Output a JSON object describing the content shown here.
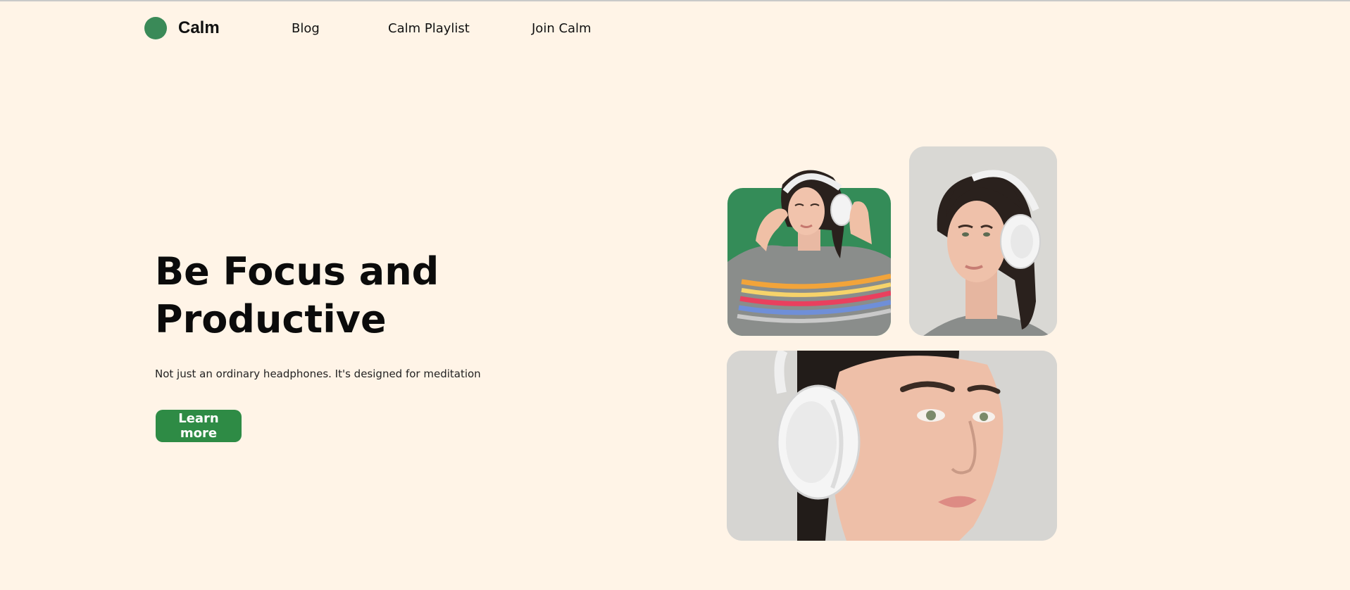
{
  "nav": {
    "brand": "Calm",
    "links": [
      "Blog",
      "Calm Playlist",
      "Join Calm"
    ]
  },
  "hero": {
    "title": "Be Focus and Productive",
    "subtitle": "Not just an ordinary headphones. It's designed for meditation",
    "cta": "Learn more"
  },
  "colors": {
    "background": "#fff4e7",
    "brand_green": "#3a8a58",
    "button_green": "#2e8b45"
  },
  "images": [
    {
      "name": "woman-headphones-green-bg"
    },
    {
      "name": "woman-headphones-profile"
    },
    {
      "name": "woman-headphones-closeup"
    }
  ]
}
